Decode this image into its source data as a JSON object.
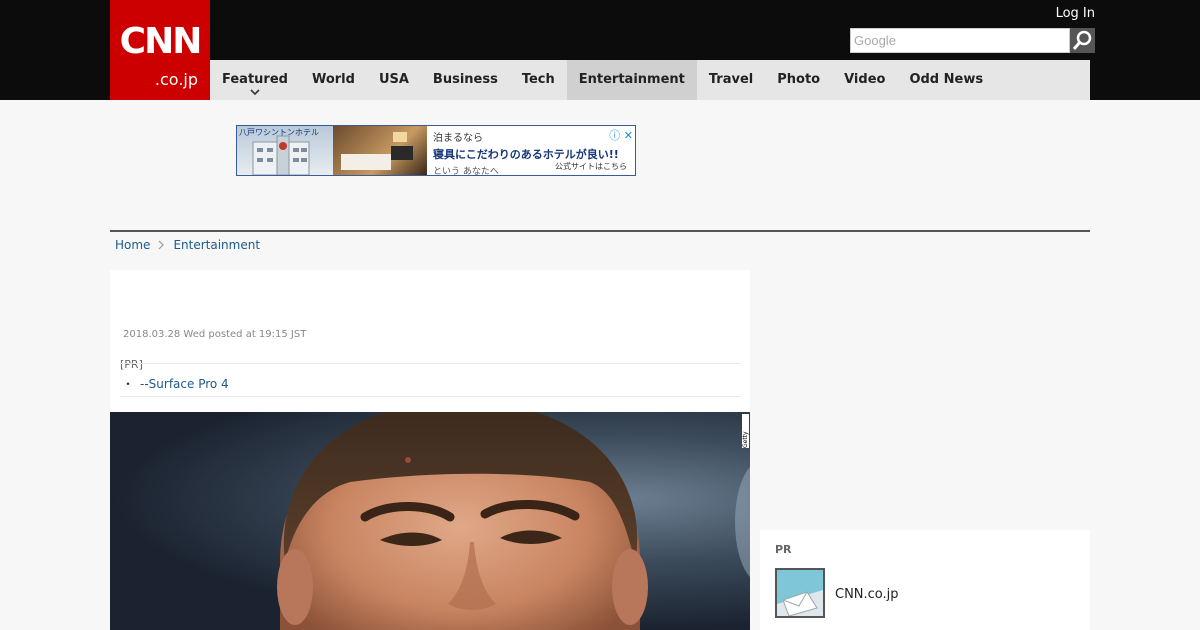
{
  "header": {
    "logo_main": "CNN",
    "logo_sub": ".co.jp",
    "login_label": "Log In",
    "search_placeholder": "Google"
  },
  "nav": {
    "items": [
      {
        "label": "Featured"
      },
      {
        "label": "World"
      },
      {
        "label": "USA"
      },
      {
        "label": "Business"
      },
      {
        "label": "Tech"
      },
      {
        "label": "Entertainment"
      },
      {
        "label": "Travel"
      },
      {
        "label": "Photo"
      },
      {
        "label": "Video"
      },
      {
        "label": "Odd News"
      }
    ],
    "active": "Entertainment"
  },
  "ad": {
    "hotel_name": "八戸ワシントンホテル",
    "line1": "泊まるなら",
    "line2": "寝具にこだわりのあるホテルが良い!!",
    "line3": "という あなたへ",
    "cta": "公式サイトはこちら"
  },
  "breadcrumb": {
    "home": "Home",
    "section": "Entertainment"
  },
  "article": {
    "dateline": "2018.03.28 Wed posted at 19:15 JST",
    "pr_tag": "[PR]",
    "pr_bullet": "・",
    "pr_link": "--Surface Pro 4",
    "photo_credit": "Getty Images"
  },
  "sidebar": {
    "pr_title": "PR",
    "item_name": "CNN.co.jp"
  },
  "colors": {
    "brand_red": "#cc0000",
    "topbar": "#0c0c0c",
    "nav_bg": "#e6e6e6",
    "link": "#1f5a8c"
  }
}
